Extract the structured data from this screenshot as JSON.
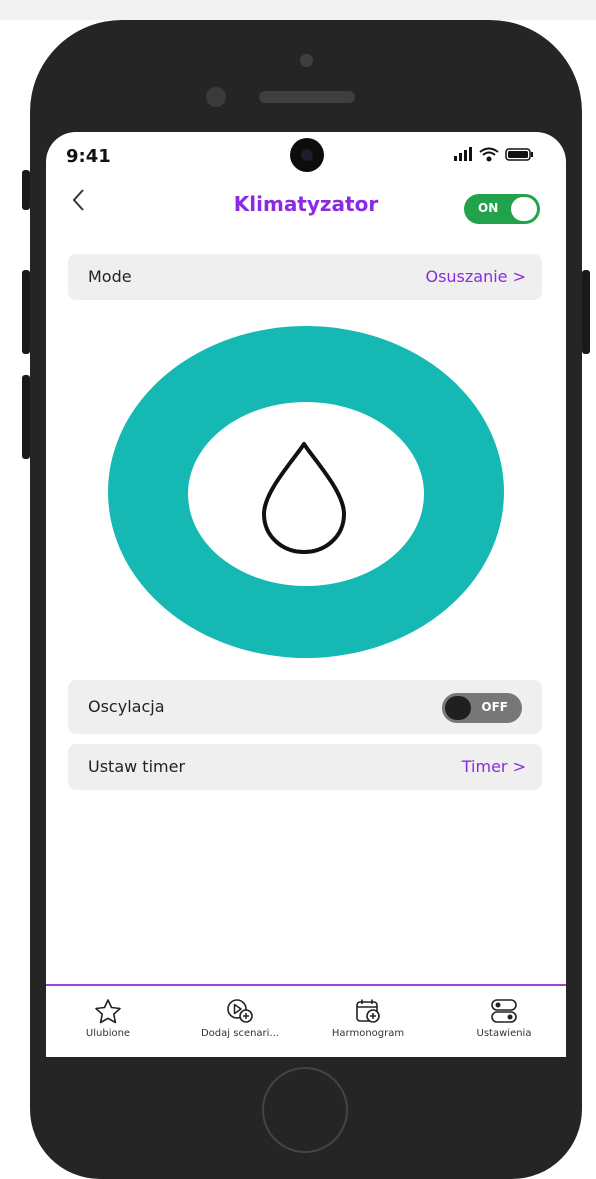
{
  "status_bar": {
    "time": "9:41",
    "indicators": "signal wifi battery"
  },
  "header": {
    "back_icon": "chevron-left-icon",
    "title": "Klimatyzator",
    "power_toggle": {
      "label": "ON",
      "state": true
    }
  },
  "mode_row": {
    "label": "Mode",
    "value": "Osuszanie >"
  },
  "mode_indicator": {
    "icon": "water-drop-icon",
    "ring_color": "#16b8b3"
  },
  "oscillation_row": {
    "label": "Oscylacja",
    "toggle": {
      "label": "OFF",
      "state": false
    }
  },
  "timer_row": {
    "label": "Ustaw timer",
    "value": "Timer >"
  },
  "bottom_nav": {
    "items": [
      {
        "icon": "star-icon",
        "label": "Ulubione"
      },
      {
        "icon": "play-add-icon",
        "label": "Dodaj scenari..."
      },
      {
        "icon": "calendar-add-icon",
        "label": "Harmonogram"
      },
      {
        "icon": "toggles-icon",
        "label": "Ustawienia"
      }
    ]
  },
  "colors": {
    "accent": "#8a2be2",
    "on_green": "#22a24a",
    "teal": "#16b8b3"
  }
}
